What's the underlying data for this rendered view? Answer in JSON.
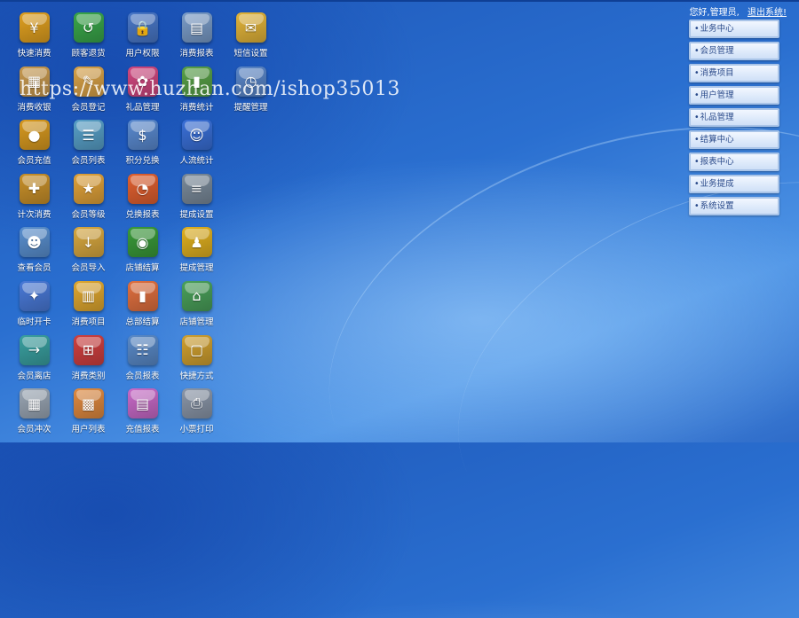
{
  "header": {
    "greeting": "您好,管理员,",
    "logout_label": "退出系统!"
  },
  "watermark": "https://www.huzhan.com/ishop35013",
  "tiles": [
    {
      "label": "快速消费",
      "icon": "quick-consume-icon",
      "glyph": "¥",
      "color": "#e0a020"
    },
    {
      "label": "顾客退货",
      "icon": "customer-return-icon",
      "glyph": "↺",
      "color": "#3aa64a"
    },
    {
      "label": "用户权限",
      "icon": "user-permission-icon",
      "glyph": "🔒",
      "color": "#4a78c8"
    },
    {
      "label": "消费报表",
      "icon": "consume-report-icon",
      "glyph": "▤",
      "color": "#7a9cc8"
    },
    {
      "label": "短信设置",
      "icon": "sms-settings-icon",
      "glyph": "✉",
      "color": "#e2b43a"
    },
    {
      "label": "消费收银",
      "icon": "cashier-icon",
      "glyph": "▦",
      "color": "#c89a50"
    },
    {
      "label": "会员登记",
      "icon": "member-register-icon",
      "glyph": "✎",
      "color": "#d9a248"
    },
    {
      "label": "礼品管理",
      "icon": "gift-manage-icon",
      "glyph": "✿",
      "color": "#d04880"
    },
    {
      "label": "消费统计",
      "icon": "consume-stats-icon",
      "glyph": "▮",
      "color": "#58a048"
    },
    {
      "label": "提醒管理",
      "icon": "reminder-manage-icon",
      "glyph": "◷",
      "color": "#5a86c8"
    },
    {
      "label": "会员充值",
      "icon": "member-recharge-icon",
      "glyph": "●",
      "color": "#d89a20"
    },
    {
      "label": "会员列表",
      "icon": "member-list-icon",
      "glyph": "☰",
      "color": "#58a0c8"
    },
    {
      "label": "积分兑换",
      "icon": "points-exchange-icon",
      "glyph": "$",
      "color": "#5a8ad0"
    },
    {
      "label": "人流统计",
      "icon": "traffic-stats-icon",
      "glyph": "☺",
      "color": "#3a70d8"
    },
    null,
    {
      "label": "计次消费",
      "icon": "count-consume-icon",
      "glyph": "✚",
      "color": "#c8902a"
    },
    {
      "label": "会员等级",
      "icon": "member-level-icon",
      "glyph": "★",
      "color": "#e0a23a"
    },
    {
      "label": "兑换报表",
      "icon": "exchange-report-icon",
      "glyph": "◔",
      "color": "#e06030"
    },
    {
      "label": "提成设置",
      "icon": "commission-settings-icon",
      "glyph": "≡",
      "color": "#7a8a9a"
    },
    null,
    {
      "label": "查看会员",
      "icon": "view-member-icon",
      "glyph": "☻",
      "color": "#5a90d0"
    },
    {
      "label": "会员导入",
      "icon": "member-import-icon",
      "glyph": "↓",
      "color": "#d8a840"
    },
    {
      "label": "店铺结算",
      "icon": "store-settlement-icon",
      "glyph": "◉",
      "color": "#3a9a3a"
    },
    {
      "label": "提成管理",
      "icon": "commission-manage-icon",
      "glyph": "♟",
      "color": "#e0b020"
    },
    null,
    {
      "label": "临时开卡",
      "icon": "temp-card-icon",
      "glyph": "✦",
      "color": "#4a7ad8"
    },
    {
      "label": "消费项目",
      "icon": "consume-items-icon",
      "glyph": "▥",
      "color": "#e0a830"
    },
    {
      "label": "总部结算",
      "icon": "hq-settlement-icon",
      "glyph": "▮",
      "color": "#e07040"
    },
    {
      "label": "店铺管理",
      "icon": "store-manage-icon",
      "glyph": "⌂",
      "color": "#4aa05a"
    },
    null,
    {
      "label": "会员离店",
      "icon": "member-leave-icon",
      "glyph": "→",
      "color": "#3aa0a0"
    },
    {
      "label": "消费类别",
      "icon": "consume-category-icon",
      "glyph": "⊞",
      "color": "#d04040"
    },
    {
      "label": "会员报表",
      "icon": "member-report-icon",
      "glyph": "☷",
      "color": "#5a8ac8"
    },
    {
      "label": "快捷方式",
      "icon": "shortcut-icon",
      "glyph": "▢",
      "color": "#d0a030"
    },
    null,
    {
      "label": "会员冲次",
      "icon": "member-offset-icon",
      "glyph": "▦",
      "color": "#9aa6b4"
    },
    {
      "label": "用户列表",
      "icon": "user-list-icon",
      "glyph": "▩",
      "color": "#e08a40"
    },
    {
      "label": "充值报表",
      "icon": "recharge-report-icon",
      "glyph": "▤",
      "color": "#c86ac8"
    },
    {
      "label": "小票打印",
      "icon": "receipt-print-icon",
      "glyph": "⎙",
      "color": "#8a96a8"
    },
    null
  ],
  "menu": [
    {
      "label": "业务中心"
    },
    {
      "label": "会员管理"
    },
    {
      "label": "消费项目"
    },
    {
      "label": "用户管理"
    },
    {
      "label": "礼品管理"
    },
    {
      "label": "结算中心"
    },
    {
      "label": "报表中心"
    },
    {
      "label": "业务提成"
    },
    {
      "label": "系统设置"
    }
  ]
}
